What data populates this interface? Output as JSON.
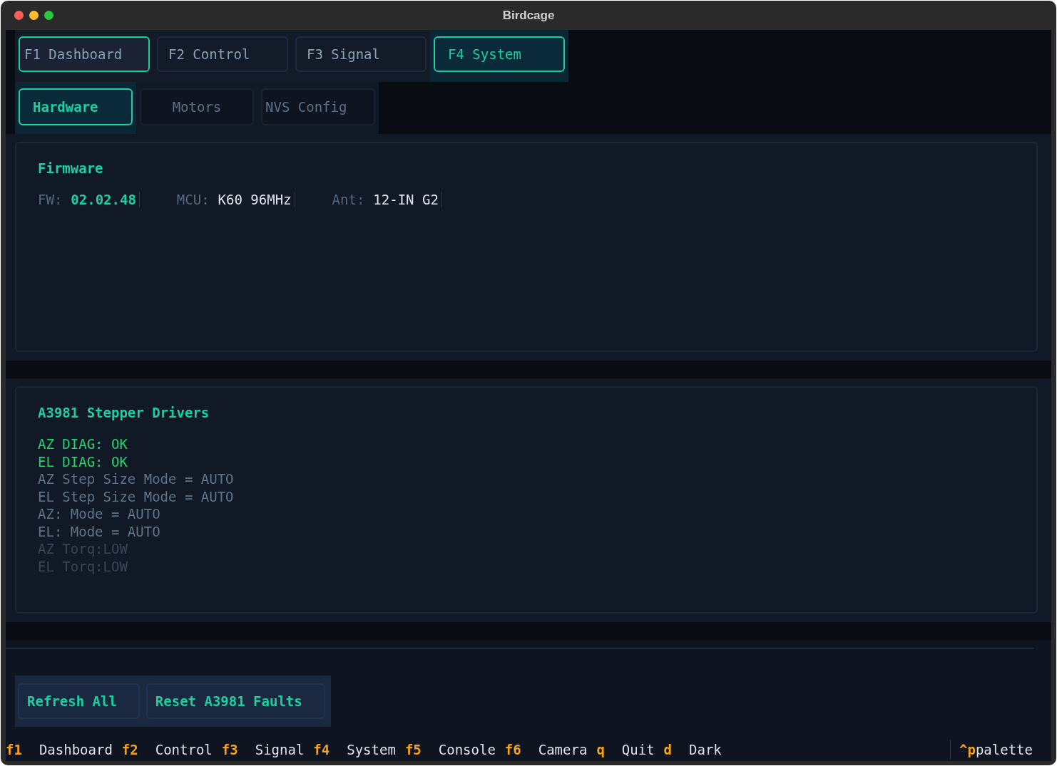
{
  "window": {
    "title": "Birdcage"
  },
  "tabs": [
    {
      "label": "F1 Dashboard",
      "selected": false,
      "focused": true
    },
    {
      "label": "F2 Control",
      "selected": false,
      "focused": false
    },
    {
      "label": "F3 Signal",
      "selected": false,
      "focused": false
    },
    {
      "label": "F4 System",
      "selected": true,
      "focused": false
    }
  ],
  "subtabs": [
    {
      "label": "Hardware",
      "selected": true
    },
    {
      "label": "Motors",
      "selected": false
    },
    {
      "label": "NVS Config",
      "selected": false
    }
  ],
  "firmware": {
    "title": "Firmware",
    "fields": [
      {
        "label": "FW:",
        "value": "02.02.48",
        "kind": "highlight"
      },
      {
        "label": "MCU:",
        "value": "K60 96MHz",
        "kind": "plain"
      },
      {
        "label": "Ant:",
        "value": "12-IN G2",
        "kind": "plain"
      }
    ]
  },
  "drivers": {
    "title": "A3981 Stepper Drivers",
    "lines": [
      {
        "text": "AZ DIAG: OK",
        "kind": "ok"
      },
      {
        "text": "EL DIAG: OK",
        "kind": "ok"
      },
      {
        "text": "AZ Step Size Mode = AUTO",
        "kind": "normal"
      },
      {
        "text": "EL Step Size Mode = AUTO",
        "kind": "normal"
      },
      {
        "text": "AZ: Mode = AUTO",
        "kind": "normal"
      },
      {
        "text": "EL: Mode = AUTO",
        "kind": "normal"
      },
      {
        "text": "AZ Torq:LOW",
        "kind": "dim"
      },
      {
        "text": "EL Torq:LOW",
        "kind": "dim"
      }
    ]
  },
  "buttons": [
    "Refresh All",
    "Reset A3981 Faults"
  ],
  "footer": {
    "keys": [
      {
        "key": "f1",
        "label": "Dashboard"
      },
      {
        "key": "f2",
        "label": "Control"
      },
      {
        "key": "f3",
        "label": "Signal"
      },
      {
        "key": "f4",
        "label": "System"
      },
      {
        "key": "f5",
        "label": "Console"
      },
      {
        "key": "f6",
        "label": "Camera"
      },
      {
        "key": "q",
        "label": "Quit"
      },
      {
        "key": "d",
        "label": "Dark"
      }
    ],
    "palette": {
      "key": "^p",
      "label": "palette"
    }
  }
}
